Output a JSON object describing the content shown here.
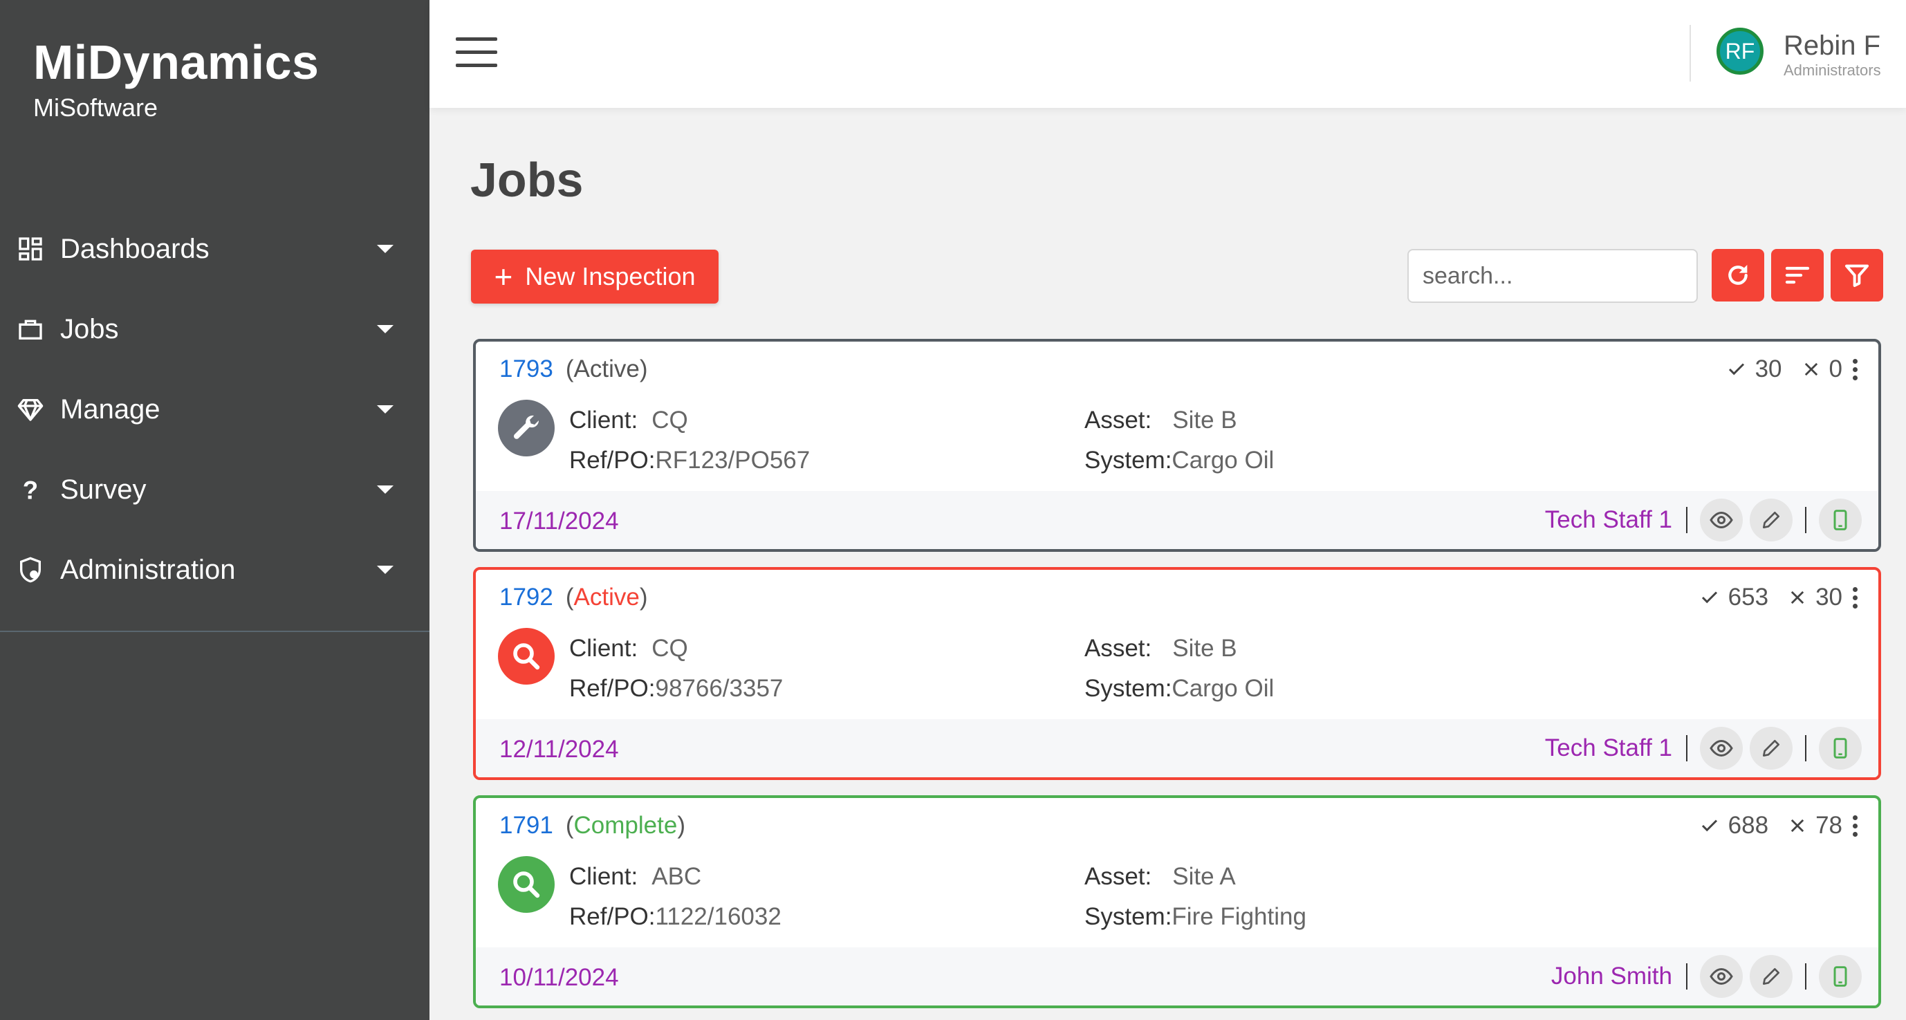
{
  "sidebar": {
    "brand_title": "MiDynamics",
    "brand_subtitle": "MiSoftware",
    "items": [
      {
        "label": "Dashboards",
        "icon": "dashboard-icon"
      },
      {
        "label": "Jobs",
        "icon": "briefcase-icon"
      },
      {
        "label": "Manage",
        "icon": "diamond-icon"
      },
      {
        "label": "Survey",
        "icon": "question-icon"
      },
      {
        "label": "Administration",
        "icon": "shield-icon"
      }
    ]
  },
  "header": {
    "user": {
      "initials": "RF",
      "name": "Rebin F",
      "role": "Administrators"
    }
  },
  "main": {
    "title": "Jobs",
    "new_button_label": "New Inspection",
    "search_placeholder": "search...",
    "toolbar_icons": [
      "refresh-icon",
      "sort-icon",
      "filter-icon"
    ]
  },
  "jobs": [
    {
      "id": "1793",
      "status": "Active",
      "status_color": "#555555",
      "border_color": "#555c63",
      "icon": "wrench-icon",
      "icon_bg": "#6b7079",
      "pass_count": "30",
      "fail_count": "0",
      "client_label": "Client:",
      "client": "CQ",
      "refpo_label": "Ref/PO:",
      "refpo": "RF123/PO567",
      "asset_label": "Asset:",
      "asset": "Site B",
      "system_label": "System:",
      "system": "Cargo Oil",
      "date": "17/11/2024",
      "staff": "Tech Staff 1"
    },
    {
      "id": "1792",
      "status": "Active",
      "status_color": "#f44336",
      "border_color": "#f44336",
      "icon": "search-icon",
      "icon_bg": "#f44336",
      "pass_count": "653",
      "fail_count": "30",
      "client_label": "Client:",
      "client": "CQ",
      "refpo_label": "Ref/PO:",
      "refpo": "98766/3357",
      "asset_label": "Asset:",
      "asset": "Site B",
      "system_label": "System:",
      "system": "Cargo Oil",
      "date": "12/11/2024",
      "staff": "Tech Staff 1"
    },
    {
      "id": "1791",
      "status": "Complete",
      "status_color": "#4caf50",
      "border_color": "#4caf50",
      "icon": "search-icon",
      "icon_bg": "#4caf50",
      "pass_count": "688",
      "fail_count": "78",
      "client_label": "Client:",
      "client": "ABC",
      "refpo_label": "Ref/PO:",
      "refpo": "1122/16032",
      "asset_label": "Asset:",
      "asset": "Site A",
      "system_label": "System:",
      "system": "Fire Fighting",
      "date": "10/11/2024",
      "staff": "John Smith"
    }
  ],
  "colors": {
    "sidebar_bg": "#444545",
    "accent": "#f44336",
    "link": "#1a6fd8",
    "purple": "#9c27b0",
    "mobile_green": "#4caf50"
  }
}
